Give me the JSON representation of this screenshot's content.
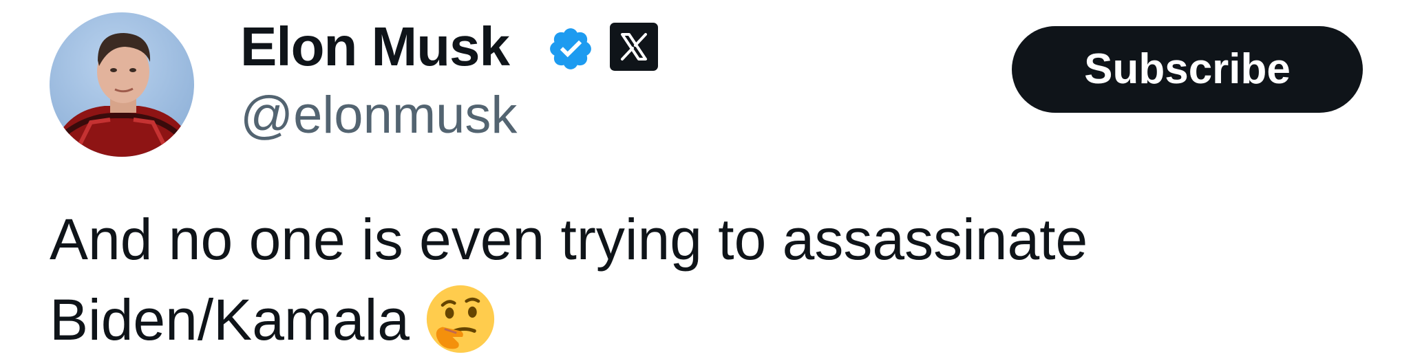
{
  "author": {
    "display_name": "Elon Musk",
    "handle": "@elonmusk",
    "verified_icon": "verified-badge-icon",
    "affiliate_icon": "x-logo-icon",
    "colors": {
      "verified": "#1d9bf0",
      "handle": "#536471",
      "text": "#0f1419"
    }
  },
  "actions": {
    "subscribe_label": "Subscribe"
  },
  "tweet": {
    "line1": "And no one is even trying to assassinate",
    "line2": "Biden/Kamala",
    "emoji": "thinking-face-icon"
  }
}
